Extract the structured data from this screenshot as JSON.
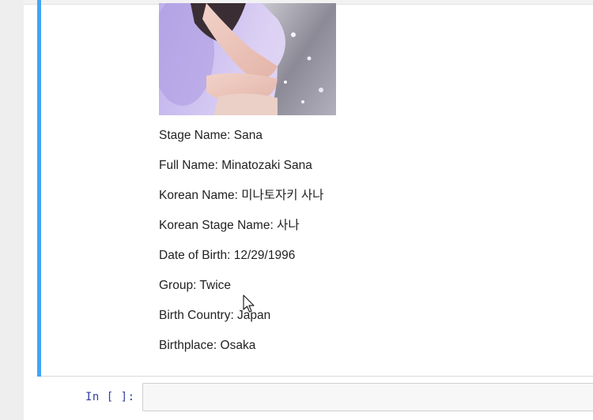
{
  "output": {
    "fields": [
      {
        "label": "Stage Name: Sana"
      },
      {
        "label": "Full Name: Minatozaki Sana"
      },
      {
        "label": "Korean Name: 미나토자키 사나"
      },
      {
        "label": "Korean Stage Name: 사나"
      },
      {
        "label": "Date of Birth: 12/29/1996"
      },
      {
        "label": "Group: Twice"
      },
      {
        "label": "Birth Country: Japan"
      },
      {
        "label": "Birthplace: Osaka"
      }
    ]
  },
  "input_cell": {
    "prompt": "In [ ]:",
    "value": ""
  },
  "colors": {
    "selected_cell_bar": "#42a5f5",
    "prompt": "#303f9f"
  }
}
